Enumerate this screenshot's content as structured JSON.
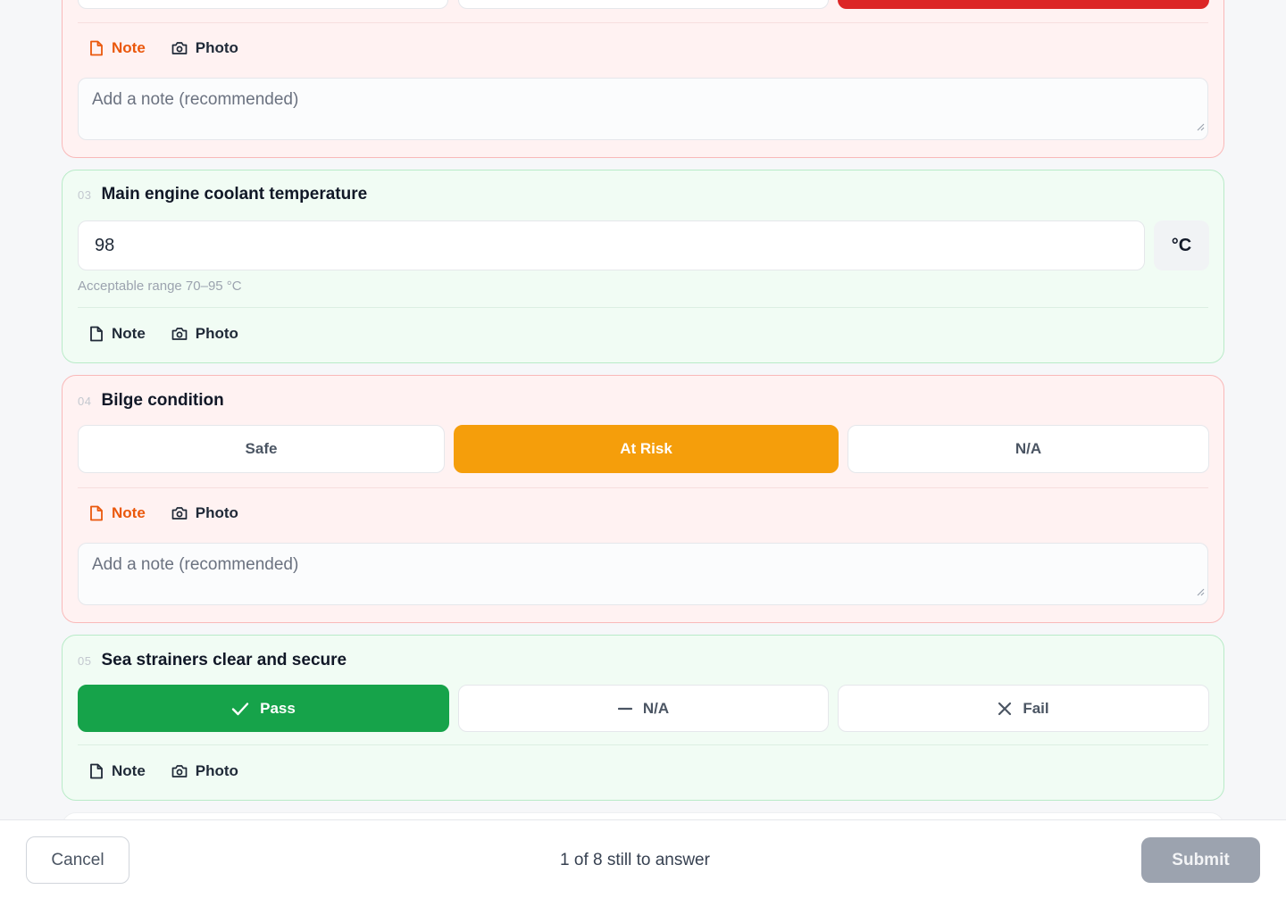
{
  "question_02": {
    "note_label": "Note",
    "photo_label": "Photo",
    "note_placeholder": "Add a note (recommended)",
    "note_active": true
  },
  "question_03": {
    "number": "03",
    "title": "Main engine coolant temperature",
    "value": "98",
    "unit": "°C",
    "hint": "Acceptable range 70–95 °C",
    "note_label": "Note",
    "photo_label": "Photo"
  },
  "question_04": {
    "number": "04",
    "title": "Bilge condition",
    "options": [
      "Safe",
      "At Risk",
      "N/A"
    ],
    "selected": "At Risk",
    "note_label": "Note",
    "photo_label": "Photo",
    "note_placeholder": "Add a note (recommended)",
    "note_active": true
  },
  "question_05": {
    "number": "05",
    "title": "Sea strainers clear and secure",
    "options": [
      {
        "label": "Pass",
        "icon": "check-icon"
      },
      {
        "label": "N/A",
        "icon": "minus-icon"
      },
      {
        "label": "Fail",
        "icon": "x-icon"
      }
    ],
    "selected": "Pass",
    "note_label": "Note",
    "photo_label": "Photo"
  },
  "footer": {
    "cancel_label": "Cancel",
    "progress_text": "1 of 8 still to answer",
    "submit_label": "Submit"
  },
  "colors": {
    "fail_red": "#dc2626",
    "at_risk_amber": "#f59e0b",
    "pass_green": "#16a34a",
    "note_highlight": "#ea580c",
    "submit_disabled": "#9ca3af"
  }
}
